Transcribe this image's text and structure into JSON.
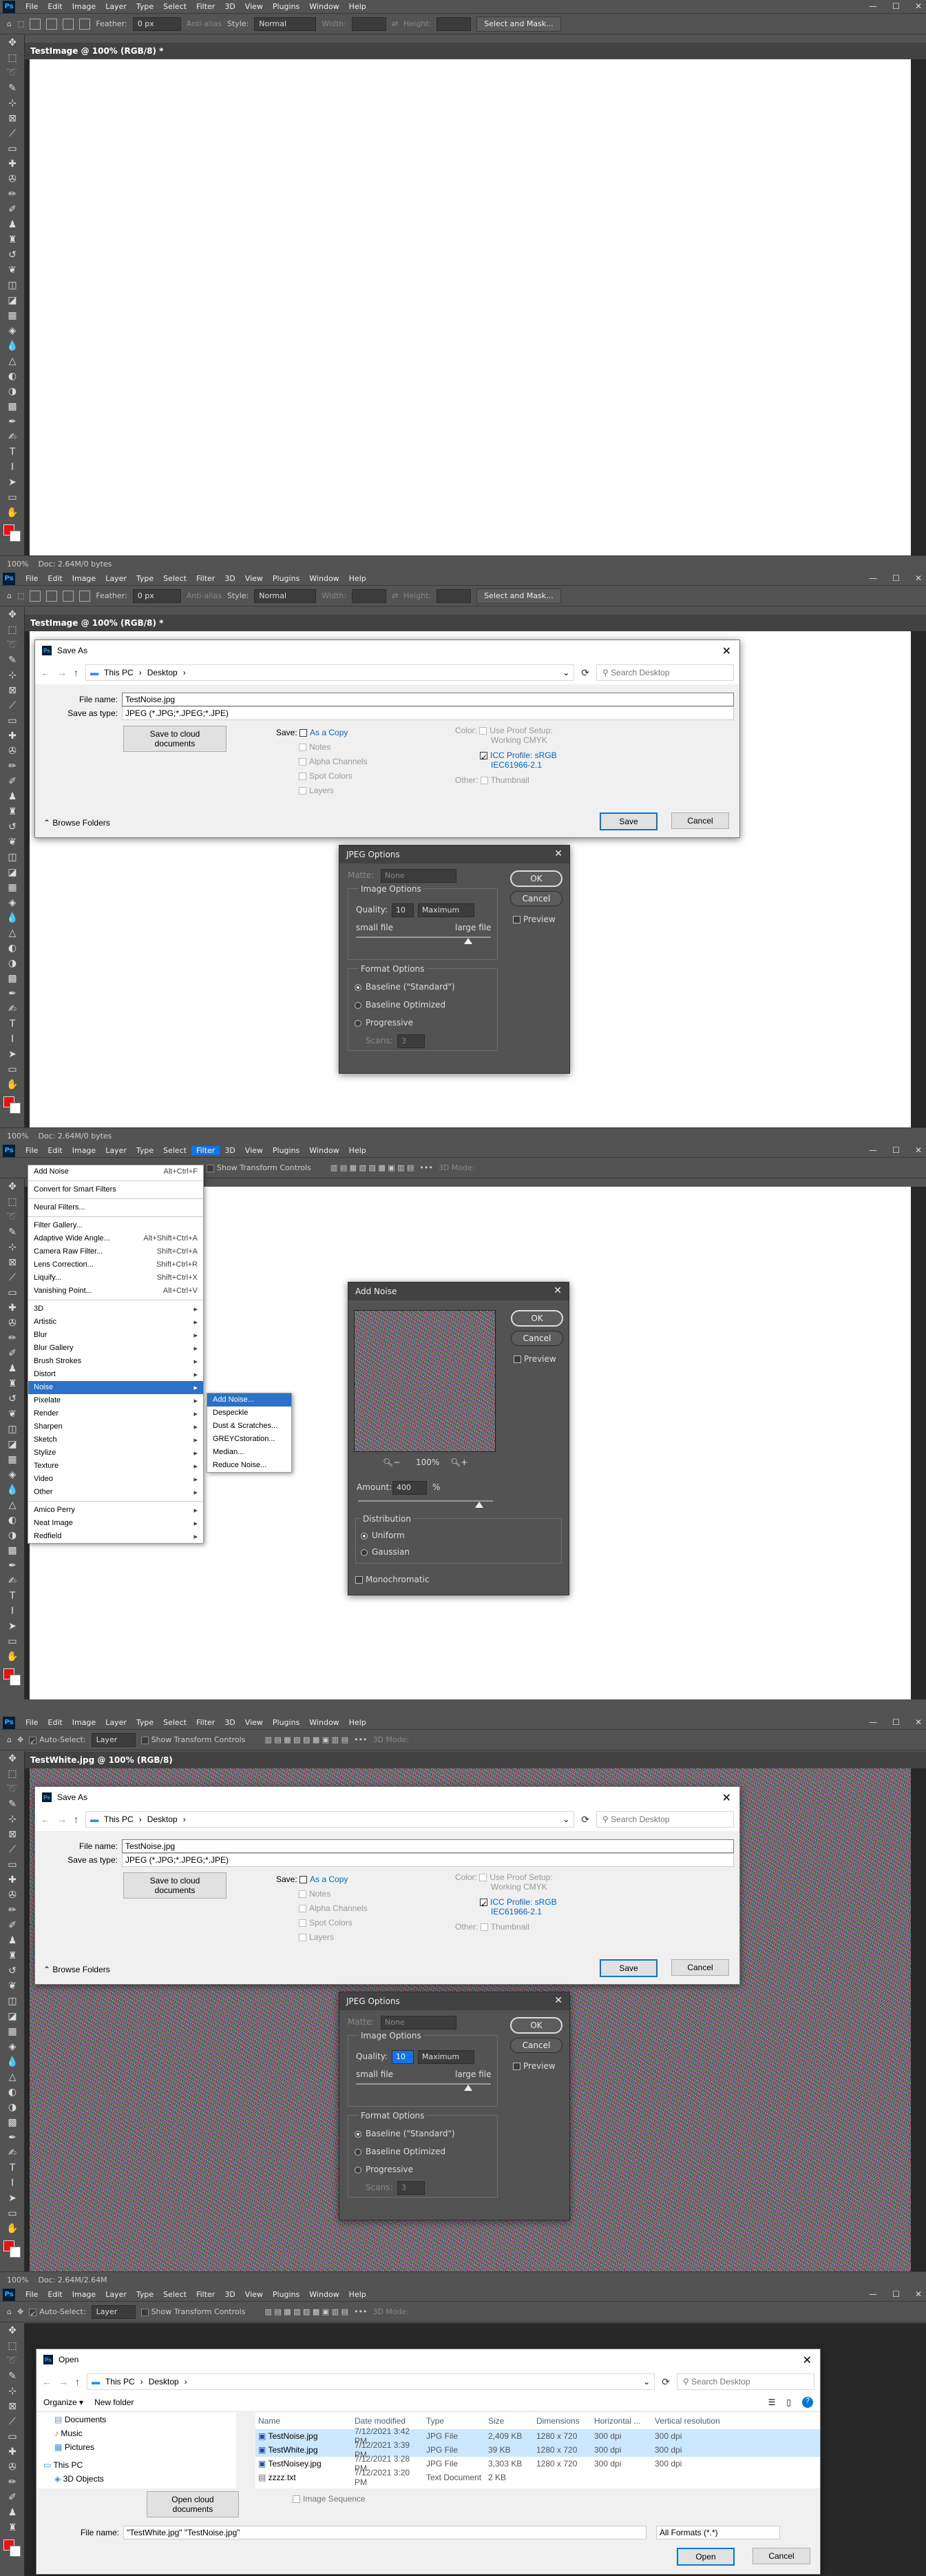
{
  "colors": {
    "ps_bg": "#535353",
    "ps_dark": "#424242",
    "accent": "#1473e6",
    "canvas_white": "#ffffff",
    "fg_swatch": "#e81010"
  },
  "menubar": {
    "items": [
      "File",
      "Edit",
      "Image",
      "Layer",
      "Type",
      "Select",
      "Filter",
      "3D",
      "View",
      "Plugins",
      "Window",
      "Help"
    ],
    "logo": "Ps",
    "win_min": "—",
    "win_max": "☐",
    "win_close": "✕"
  },
  "optbar_marquee": {
    "feather_label": "Feather:",
    "feather_value": "0 px",
    "antialias": "Anti-alias",
    "style_label": "Style:",
    "style_value": "Normal",
    "width_label": "Width:",
    "height_label": "Height:",
    "select_mask": "Select and Mask..."
  },
  "optbar_move": {
    "auto_select": "Auto-Select:",
    "layer": "Layer",
    "transform": "Show Transform Controls",
    "mode3d": "3D Mode:"
  },
  "frame1": {
    "doc_title": "TestImage @ 100% (RGB/8) *",
    "status": "100%",
    "doc_info": "Doc: 2.64M/0 bytes"
  },
  "frame2": {
    "doc_title": "TestImage @ 100% (RGB/8) *",
    "status": "100%",
    "doc_info": "Doc: 2.64M/0 bytes",
    "saveas": {
      "title": "Save As",
      "path_pc": "This PC",
      "path_desktop": "Desktop",
      "search": "Search Desktop",
      "file_name_label": "File name:",
      "file_name": "TestNoise.jpg",
      "type_label": "Save as type:",
      "type_value": "JPEG (*.JPG;*.JPEG;*.JPE)",
      "cloud": "Save to cloud documents",
      "save_label": "Save:",
      "as_copy": "As a Copy",
      "notes": "Notes",
      "alpha": "Alpha Channels",
      "spot": "Spot Colors",
      "layers": "Layers",
      "color_label": "Color:",
      "proof": "Use Proof Setup:",
      "proof_sub": "Working CMYK",
      "icc": "ICC Profile: sRGB",
      "icc_sub": "IEC61966-2.1",
      "other_label": "Other:",
      "thumb": "Thumbnail",
      "browse": "Browse Folders",
      "save_btn": "Save",
      "cancel_btn": "Cancel"
    },
    "jpeg": {
      "title": "JPEG Options",
      "matte_label": "Matte:",
      "matte_value": "None",
      "image_options": "Image Options",
      "quality_label": "Quality:",
      "quality_value": "10",
      "quality_preset": "Maximum",
      "small": "small file",
      "large": "large file",
      "format_options": "Format Options",
      "baseline": "Baseline (\"Standard\")",
      "baseline_opt": "Baseline Optimized",
      "progressive": "Progressive",
      "scans_label": "Scans:",
      "scans_value": "3",
      "ok": "OK",
      "cancel": "Cancel",
      "preview": "Preview",
      "quality_fraction": 0.83
    }
  },
  "frame3": {
    "filter_menu": {
      "top": [
        {
          "label": "Add Noise",
          "sc": "Alt+Ctrl+F"
        }
      ],
      "g2": [
        {
          "label": "Convert for Smart Filters",
          "sc": ""
        }
      ],
      "g3": [
        {
          "label": "Neural Filters...",
          "sc": ""
        }
      ],
      "g4": [
        {
          "label": "Filter Gallery...",
          "sc": ""
        },
        {
          "label": "Adaptive Wide Angle...",
          "sc": "Alt+Shift+Ctrl+A"
        },
        {
          "label": "Camera Raw Filter...",
          "sc": "Shift+Ctrl+A"
        },
        {
          "label": "Lens Correction...",
          "sc": "Shift+Ctrl+R"
        },
        {
          "label": "Liquify...",
          "sc": "Shift+Ctrl+X"
        },
        {
          "label": "Vanishing Point...",
          "sc": "Alt+Ctrl+V"
        }
      ],
      "g5": [
        "3D",
        "Artistic",
        "Blur",
        "Blur Gallery",
        "Brush Strokes",
        "Distort",
        "Noise",
        "Pixelate",
        "Render",
        "Sharpen",
        "Sketch",
        "Stylize",
        "Texture",
        "Video",
        "Other"
      ],
      "g6": [
        "Amico Perry",
        "Neat Image",
        "Redfield"
      ],
      "noise_sub": [
        "Add Noise...",
        "Despeckle",
        "Dust & Scratches...",
        "GREYCstoration...",
        "Median...",
        "Reduce Noise..."
      ]
    },
    "add_noise": {
      "title": "Add Noise",
      "ok": "OK",
      "cancel": "Cancel",
      "preview": "Preview",
      "zoom": "100%",
      "amount_label": "Amount:",
      "amount_value": "400",
      "amount_unit": "%",
      "distribution": "Distribution",
      "uniform": "Uniform",
      "gaussian": "Gaussian",
      "mono": "Monochromatic",
      "amount_fraction": 0.9
    }
  },
  "frame4": {
    "doc_title": "TestWhite.jpg @ 100% (RGB/8)",
    "status": "100%",
    "doc_info": "Doc: 2.64M/2.64M",
    "saveas": {
      "title": "Save As",
      "path_pc": "This PC",
      "path_desktop": "Desktop",
      "search": "Search Desktop",
      "file_name_label": "File name:",
      "file_name": "TestNoise.jpg",
      "type_label": "Save as type:",
      "type_value": "JPEG (*.JPG;*.JPEG;*.JPE)",
      "cloud": "Save to cloud documents",
      "save_label": "Save:",
      "as_copy": "As a Copy",
      "notes": "Notes",
      "alpha": "Alpha Channels",
      "spot": "Spot Colors",
      "layers": "Layers",
      "color_label": "Color:",
      "proof": "Use Proof Setup:",
      "proof_sub": "Working CMYK",
      "icc": "ICC Profile: sRGB",
      "icc_sub": "IEC61966-2.1",
      "other_label": "Other:",
      "thumb": "Thumbnail",
      "browse": "Browse Folders",
      "save_btn": "Save",
      "cancel_btn": "Cancel"
    },
    "jpeg": {
      "title": "JPEG Options",
      "matte_label": "Matte:",
      "matte_value": "None",
      "image_options": "Image Options",
      "quality_label": "Quality:",
      "quality_value": "10",
      "quality_preset": "Maximum",
      "small": "small file",
      "large": "large file",
      "format_options": "Format Options",
      "baseline": "Baseline (\"Standard\")",
      "baseline_opt": "Baseline Optimized",
      "progressive": "Progressive",
      "scans_label": "Scans:",
      "scans_value": "3",
      "ok": "OK",
      "cancel": "Cancel",
      "preview": "Preview",
      "quality_fraction": 0.83
    }
  },
  "frame5": {
    "open": {
      "title": "Open",
      "path_pc": "This PC",
      "path_desktop": "Desktop",
      "search": "Search Desktop",
      "organize": "Organize ▾",
      "new_folder": "New folder",
      "tree": [
        "Documents",
        "Music",
        "Pictures",
        "This PC",
        "3D Objects"
      ],
      "columns": [
        "Name",
        "Date modified",
        "Type",
        "Size",
        "Dimensions",
        "Horizontal ...",
        "Vertical resolution"
      ],
      "files": [
        {
          "name": "TestNoise.jpg",
          "date": "7/12/2021 3:42 PM",
          "type": "JPG File",
          "size": "2,409 KB",
          "dim": "1280 x 720",
          "h": "300 dpi",
          "v": "300 dpi",
          "sel": true
        },
        {
          "name": "TestWhite.jpg",
          "date": "7/12/2021 3:39 PM",
          "type": "JPG File",
          "size": "39 KB",
          "dim": "1280 x 720",
          "h": "300 dpi",
          "v": "300 dpi",
          "sel": true
        },
        {
          "name": "TestNoisey.jpg",
          "date": "7/12/2021 3:28 PM",
          "type": "JPG File",
          "size": "3,303 KB",
          "dim": "1280 x 720",
          "h": "300 dpi",
          "v": "300 dpi",
          "sel": false
        },
        {
          "name": "zzzz.txt",
          "date": "7/12/2021 3:20 PM",
          "type": "Text Document",
          "size": "2 KB",
          "dim": "",
          "h": "",
          "v": "",
          "sel": false
        }
      ],
      "cloud": "Open cloud documents",
      "image_seq": "Image Sequence",
      "file_name_label": "File name:",
      "file_name": "\"TestWhite.jpg\" \"TestNoise.jpg\"",
      "formats": "All Formats (*.*)",
      "open_btn": "Open",
      "cancel_btn": "Cancel"
    }
  }
}
